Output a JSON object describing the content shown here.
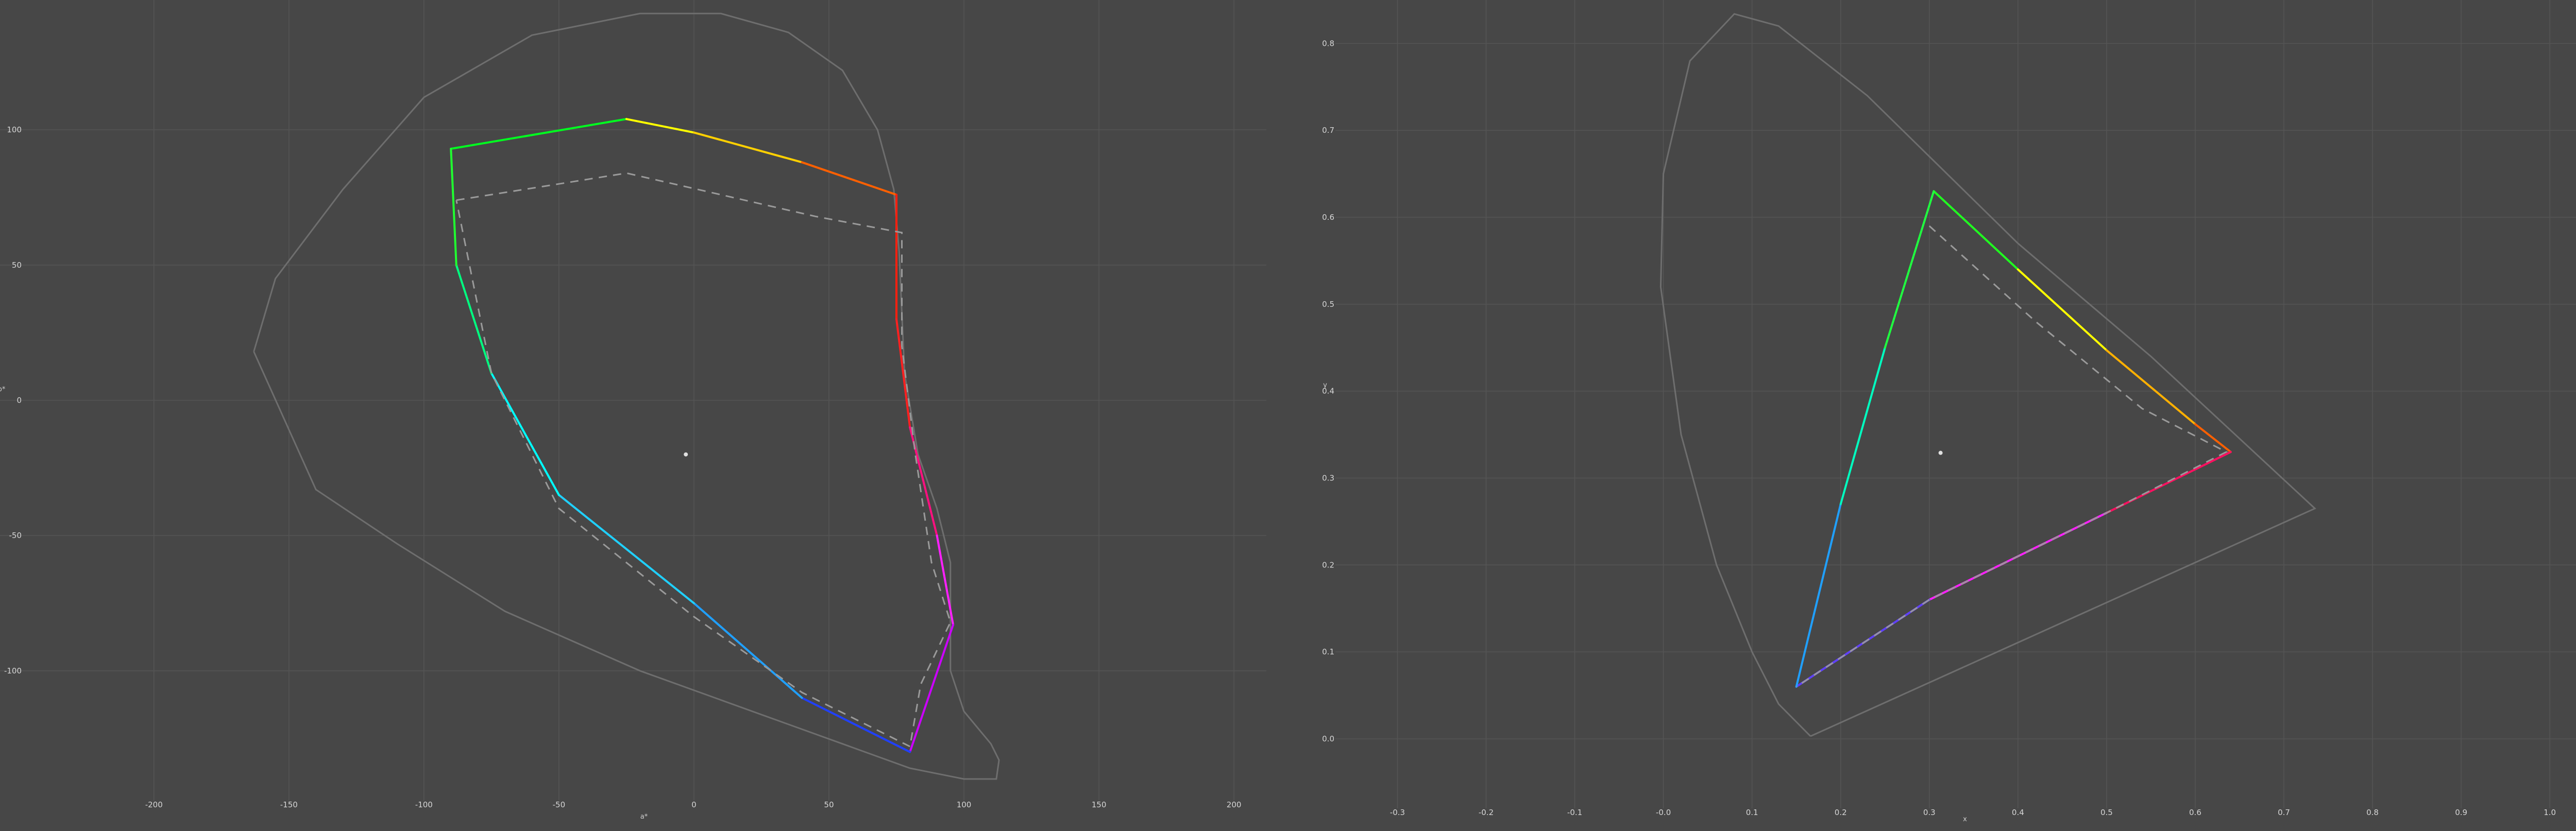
{
  "chart_data": [
    {
      "type": "line",
      "title": "",
      "xlabel": "a*",
      "ylabel": "b*",
      "xlim": [
        -257,
        212
      ],
      "ylim": [
        -148,
        148
      ],
      "xticks": [
        -200,
        -150,
        -100,
        -50,
        0,
        50,
        100,
        150,
        200
      ],
      "yticks": [
        100,
        50,
        0,
        -50,
        -100
      ],
      "xtick_labels": [
        "-200",
        "-150",
        "-100",
        "-50",
        "0",
        "50",
        "100",
        "150",
        "200"
      ],
      "ytick_labels": [
        "100",
        "50",
        "0",
        "-50",
        "-100"
      ],
      "grid": true,
      "series": [
        {
          "style": "solid-gray",
          "points": [
            [
              -163,
              18
            ],
            [
              -155,
              45
            ],
            [
              -130,
              78
            ],
            [
              -100,
              112
            ],
            [
              -60,
              135
            ],
            [
              -20,
              143
            ],
            [
              10,
              143
            ],
            [
              35,
              136
            ],
            [
              55,
              122
            ],
            [
              68,
              100
            ],
            [
              74,
              78
            ],
            [
              76,
              55
            ],
            [
              78,
              10
            ],
            [
              83,
              -20
            ],
            [
              90,
              -40
            ],
            [
              95,
              -60
            ],
            [
              95,
              -100
            ],
            [
              100,
              -115
            ],
            [
              110,
              -127
            ],
            [
              113,
              -133
            ],
            [
              112,
              -140
            ],
            [
              100,
              -140
            ],
            [
              80,
              -136
            ],
            [
              30,
              -118
            ],
            [
              -20,
              -100
            ],
            [
              -70,
              -78
            ],
            [
              -110,
              -53
            ],
            [
              -140,
              -33
            ],
            [
              -163,
              18
            ]
          ]
        },
        {
          "style": "gamut-colored",
          "points": [
            [
              -90,
              93
            ],
            [
              -25,
              104
            ],
            [
              0,
              99
            ],
            [
              40,
              88
            ],
            [
              75,
              76
            ],
            [
              75,
              30
            ],
            [
              80,
              -10
            ],
            [
              90,
              -50
            ],
            [
              96,
              -83
            ],
            [
              80,
              -130
            ],
            [
              40,
              -110
            ],
            [
              0,
              -75
            ],
            [
              -50,
              -35
            ],
            [
              -75,
              10
            ],
            [
              -88,
              50
            ],
            [
              -90,
              93
            ]
          ],
          "colors": [
            "#00ff20",
            "#ffff00",
            "#ffd000",
            "#ff6000",
            "#ff2010",
            "#ff2020",
            "#ff1080",
            "#ff20ff",
            "#cc00ff",
            "#2040ff",
            "#20a0ff",
            "#20d0ff",
            "#00ffff",
            "#00ff80",
            "#20ff30"
          ]
        },
        {
          "style": "dashed-gray",
          "points": [
            [
              -88,
              74
            ],
            [
              -50,
              80
            ],
            [
              -25,
              84
            ],
            [
              10,
              76
            ],
            [
              45,
              68
            ],
            [
              77,
              62
            ],
            [
              77,
              20
            ],
            [
              82,
              -20
            ],
            [
              88,
              -60
            ],
            [
              95,
              -82
            ],
            [
              84,
              -105
            ],
            [
              80,
              -128
            ],
            [
              40,
              -108
            ],
            [
              0,
              -80
            ],
            [
              -50,
              -40
            ],
            [
              -75,
              10
            ],
            [
              -88,
              74
            ]
          ]
        }
      ],
      "white_point": [
        -3,
        -20
      ]
    },
    {
      "type": "line",
      "title": "",
      "xlabel": "x",
      "ylabel": "y",
      "xlim": [
        -0.37,
        1.04
      ],
      "ylim": [
        -0.08,
        0.85
      ],
      "xticks": [
        -0.3,
        -0.2,
        -0.1,
        0.0,
        0.1,
        0.2,
        0.3,
        0.4,
        0.5,
        0.6,
        0.7,
        0.8,
        0.9,
        1.0
      ],
      "yticks": [
        0.8,
        0.7,
        0.6,
        0.5,
        0.4,
        0.3,
        0.2,
        0.1,
        0.0
      ],
      "xtick_labels": [
        "-0.3",
        "-0.2",
        "-0.1",
        "-0.0",
        "0.1",
        "0.2",
        "0.3",
        "0.4",
        "0.5",
        "0.6",
        "0.7",
        "0.8",
        "0.9",
        "1.0"
      ],
      "ytick_labels": [
        "0.8",
        "0.7",
        "0.6",
        "0.5",
        "0.4",
        "0.3",
        "0.2",
        "0.1",
        "0.0"
      ],
      "grid": true,
      "series": [
        {
          "style": "solid-gray",
          "points": [
            [
              0.166,
              0.003
            ],
            [
              0.13,
              0.04
            ],
            [
              0.1,
              0.1
            ],
            [
              0.06,
              0.2
            ],
            [
              0.02,
              0.35
            ],
            [
              -0.003,
              0.52
            ],
            [
              0.0,
              0.65
            ],
            [
              0.03,
              0.78
            ],
            [
              0.08,
              0.834
            ],
            [
              0.13,
              0.82
            ],
            [
              0.23,
              0.74
            ],
            [
              0.4,
              0.57
            ],
            [
              0.55,
              0.44
            ],
            [
              0.735,
              0.265
            ],
            [
              0.166,
              0.003
            ]
          ]
        },
        {
          "style": "gamut-colored",
          "points": [
            [
              0.305,
              0.63
            ],
            [
              0.4,
              0.54
            ],
            [
              0.5,
              0.447
            ],
            [
              0.6,
              0.362
            ],
            [
              0.64,
              0.33
            ],
            [
              0.5,
              0.26
            ],
            [
              0.3,
              0.16
            ],
            [
              0.15,
              0.06
            ],
            [
              0.2,
              0.27
            ],
            [
              0.25,
              0.45
            ],
            [
              0.305,
              0.63
            ]
          ],
          "colors": [
            "#20ff20",
            "#ffff00",
            "#ffb000",
            "#ff6000",
            "#ff1060",
            "#ff20ff",
            "#6040ff",
            "#20a0ff",
            "#00ffc0",
            "#20ff40"
          ]
        },
        {
          "style": "dashed-gray",
          "points": [
            [
              0.3,
              0.59
            ],
            [
              0.42,
              0.48
            ],
            [
              0.54,
              0.38
            ],
            [
              0.635,
              0.33
            ],
            [
              0.5,
              0.26
            ],
            [
              0.3,
              0.16
            ],
            [
              0.15,
              0.06
            ]
          ]
        }
      ],
      "white_point": [
        0.3127,
        0.329
      ]
    }
  ]
}
